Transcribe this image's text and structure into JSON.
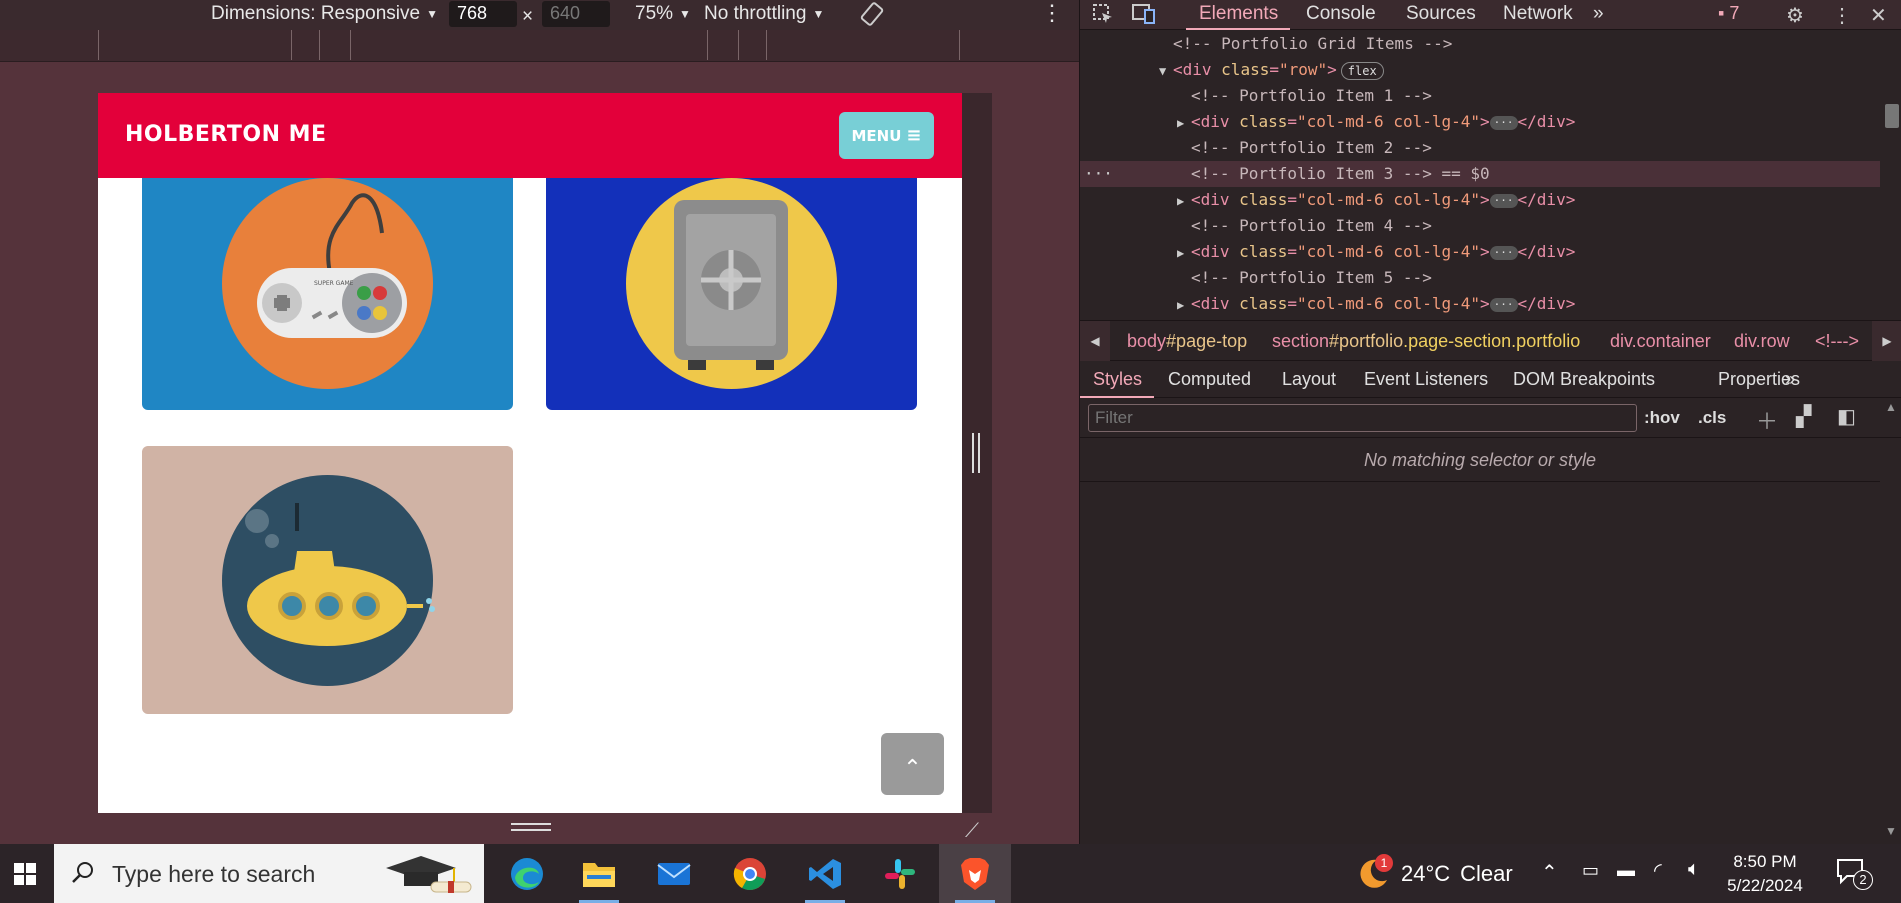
{
  "device_toolbar": {
    "dimensions_label": "Dimensions: Responsive",
    "width_value": "768",
    "times": "×",
    "height_placeholder": "640",
    "zoom": "75%",
    "throttling": "No throttling"
  },
  "site": {
    "brand": "HOLBERTON ME",
    "menu_label": "MENU",
    "menu_icon": "≡",
    "scroll_top_icon": "⌃",
    "cards": [
      {
        "name": "game-controller-card",
        "bg": "#1f86c4",
        "circle": "#e8803b"
      },
      {
        "name": "safe-card",
        "bg": "#1330ba",
        "circle": "#efc84a"
      },
      {
        "name": "submarine-card",
        "bg": "#d0b3a5",
        "circle": "#2e4e63"
      }
    ],
    "controller_text": "SUPER GAME"
  },
  "devtools": {
    "tabs": [
      "Elements",
      "Console",
      "Sources",
      "Network"
    ],
    "more_tabs": "»",
    "issues_count": "7",
    "dom_lines": [
      {
        "kind": "comment",
        "text": "<!-- Portfolio Grid Items -->"
      },
      {
        "kind": "row",
        "open": "<div ",
        "attr": "class",
        "val": "\"row\"",
        "close": ">",
        "badge": "flex"
      },
      {
        "kind": "comment",
        "text": "<!-- Portfolio Item 1 -->"
      },
      {
        "kind": "div",
        "attr": "class",
        "val": "\"col-md-6 col-lg-4\"",
        "end": "</div>"
      },
      {
        "kind": "comment",
        "text": "<!-- Portfolio Item 2 -->"
      },
      {
        "kind": "comment-selected",
        "text": "<!-- Portfolio Item 3 --> == $0"
      },
      {
        "kind": "div",
        "attr": "class",
        "val": "\"col-md-6 col-lg-4\"",
        "end": "</div>"
      },
      {
        "kind": "comment",
        "text": "<!-- Portfolio Item 4 -->"
      },
      {
        "kind": "div",
        "attr": "class",
        "val": "\"col-md-6 col-lg-4\"",
        "end": "</div>"
      },
      {
        "kind": "comment",
        "text": "<!-- Portfolio Item 5 -->"
      },
      {
        "kind": "div",
        "attr": "class",
        "val": "\"col-md-6 col-lg-4\"",
        "end": "</div>"
      }
    ],
    "breadcrumb": {
      "body": "body",
      "body_id": "#page-top",
      "section": "section",
      "section_id": "#portfolio",
      "section_class": ".page-section.portfolio",
      "container": "div.container",
      "row": "div.row",
      "comment": "<!--->"
    },
    "styles_tabs": [
      "Styles",
      "Computed",
      "Layout",
      "Event Listeners",
      "DOM Breakpoints",
      "Properties"
    ],
    "filter_placeholder": "Filter",
    "hov": ":hov",
    "cls": ".cls",
    "no_match": "No matching selector or style"
  },
  "taskbar": {
    "search_placeholder": "Type here to search",
    "weather_temp": "24°C",
    "weather_desc": "Clear",
    "time": "8:50 PM",
    "date": "5/22/2024",
    "notification_count": "2",
    "brave_badge": "1"
  },
  "colors": {
    "nav_red": "#e3003a",
    "menu_teal": "#78cfd6",
    "devtools_accent": "#f2a9b8"
  }
}
